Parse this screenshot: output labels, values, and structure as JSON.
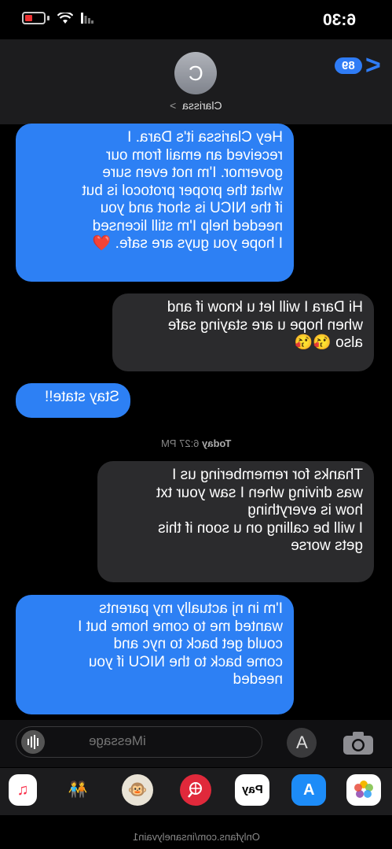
{
  "status_bar": {
    "time": "6:30"
  },
  "header": {
    "avatar_initial": "C",
    "contact_name": "Clarissa",
    "contact_chevron": ">",
    "back_count": "89",
    "back_chevron": "<"
  },
  "messages": [
    {
      "type": "sent",
      "text": "Hey Clarissa it's Dara. I\nreceived an email from our\ngovernor. I'm not even sure\nwhat the proper protocol is but\nif the NICU is short and you\nneeded help I'm still licensed\nI hope you guys are safe. ❤️"
    },
    {
      "type": "received",
      "text": "Hi Dara I will let u know if and\nwhen hope u are staying safe\nalso 😘😘"
    },
    {
      "type": "sent",
      "text": "Stay state!!"
    },
    {
      "type": "received",
      "text": "Thanks for remembering us I\nwas driving when I saw your txt\nhow is everything\nI will be calling on u soon if this\ngets worse"
    },
    {
      "type": "sent",
      "text": "I'm in nj actually my parents\nwanted me to come home but I\ncould get back to nyc and\ncome back to the NICU if you\nneeded"
    }
  ],
  "timestamp": {
    "day": "Today",
    "time": "6:27 PM"
  },
  "input": {
    "placeholder": "iMessage"
  },
  "app_strip": [
    {
      "name": "Photos",
      "icon": "photos-icon"
    },
    {
      "name": "App Store",
      "icon": "app-store-icon"
    },
    {
      "name": "Apple Pay",
      "icon": "apple-pay-icon",
      "label": "Pay"
    },
    {
      "name": "Search",
      "icon": "search-globe-icon"
    },
    {
      "name": "Animoji",
      "icon": "monkey-icon"
    },
    {
      "name": "Memoji",
      "icon": "memoji-icon"
    },
    {
      "name": "Music",
      "icon": "music-icon"
    }
  ],
  "watermark": "Onlyfans.com/insanelyvain1",
  "colors": {
    "sent_bubble": "#2d80f4",
    "received_bubble": "#2b2b2d",
    "accent": "#2f7cf6"
  }
}
